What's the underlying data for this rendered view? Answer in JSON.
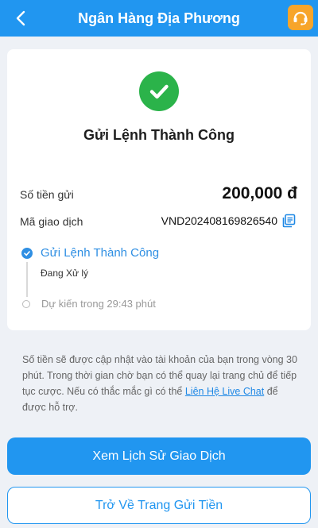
{
  "header": {
    "title": "Ngân Hàng Địa Phương",
    "back_icon": "chevron-left-icon",
    "support_icon": "headset-icon"
  },
  "result": {
    "title": "Gửi Lệnh Thành Công",
    "icon": "check-circle-icon"
  },
  "details": {
    "amount_label": "Số tiền gửi",
    "amount_value": "200,000 đ",
    "txid_label": "Mã giao dịch",
    "txid_value": "VND202408169826540",
    "copy_icon": "copy-icon"
  },
  "timeline": {
    "step1_title": "Gửi Lệnh Thành Công",
    "step1_sub": "Đang Xử lý",
    "step2_text": "Dự kiến trong 29:43 phút"
  },
  "notice": {
    "text_before": "Số tiền sẽ được cập nhật vào tài khoản của bạn trong vòng 30 phút. Trong thời gian chờ bạn có thể quay lại trang chủ để tiếp tục cược. Nếu có thắc mắc gì có thể ",
    "link_text": "Liên Hệ Live Chat",
    "text_after": " để được hỗ trợ."
  },
  "buttons": {
    "history_label": "Xem Lịch Sử Giao Dịch",
    "back_to_deposit_label": "Trở Về Trang Gửi Tiền"
  },
  "colors": {
    "primary": "#2196f0",
    "success": "#2bb34a",
    "support": "#f7a52b"
  }
}
